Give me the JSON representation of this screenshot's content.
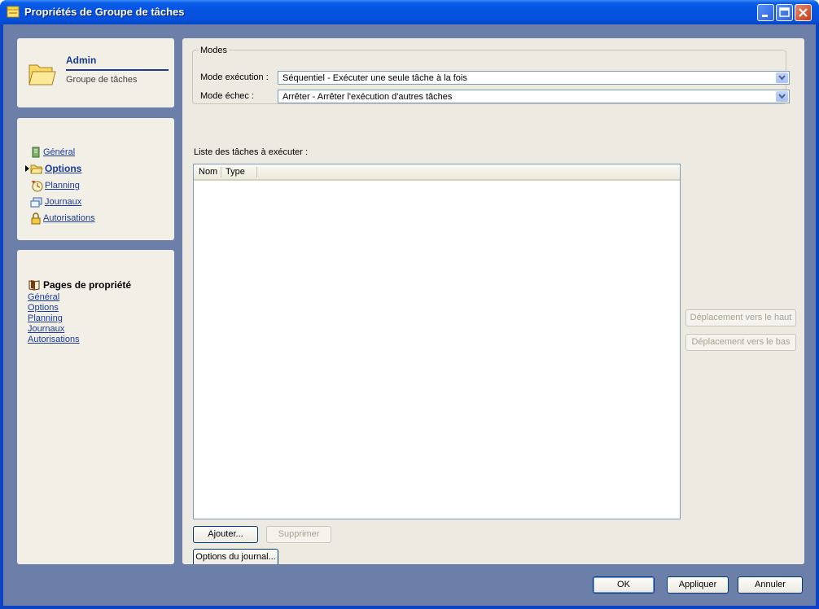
{
  "window": {
    "title": "Propriétés de Groupe de tâches"
  },
  "header": {
    "name": "Admin",
    "type": "Groupe de tâches"
  },
  "nav": {
    "items": [
      {
        "label": "Général",
        "icon": "document-icon"
      },
      {
        "label": "Options",
        "icon": "folder-icon",
        "active": true
      },
      {
        "label": "Planning",
        "icon": "clock-icon"
      },
      {
        "label": "Journaux",
        "icon": "logs-icon"
      },
      {
        "label": "Autorisations",
        "icon": "lock-icon"
      }
    ]
  },
  "property_pages": {
    "title": "Pages de propriété",
    "links": [
      "Général",
      "Options",
      "Planning",
      "Journaux",
      "Autorisations"
    ]
  },
  "modes": {
    "legend": "Modes",
    "execution_label": "Mode exécution :",
    "execution_value": "Séquentiel - Exécuter une seule tâche à la fois",
    "failure_label": "Mode échec :",
    "failure_value": "Arrêter - Arrêter l'exécution d'autres tâches"
  },
  "tasks": {
    "label": "Liste des tâches à exécuter :",
    "columns": [
      "Nom",
      "Type"
    ],
    "rows": []
  },
  "buttons": {
    "move_up": "Déplacement vers le haut",
    "move_down": "Déplacement vers le bas",
    "add": "Ajouter...",
    "remove": "Supprimer",
    "log_options": "Options du journal...",
    "ok": "OK",
    "apply": "Appliquer",
    "cancel": "Annuler"
  }
}
